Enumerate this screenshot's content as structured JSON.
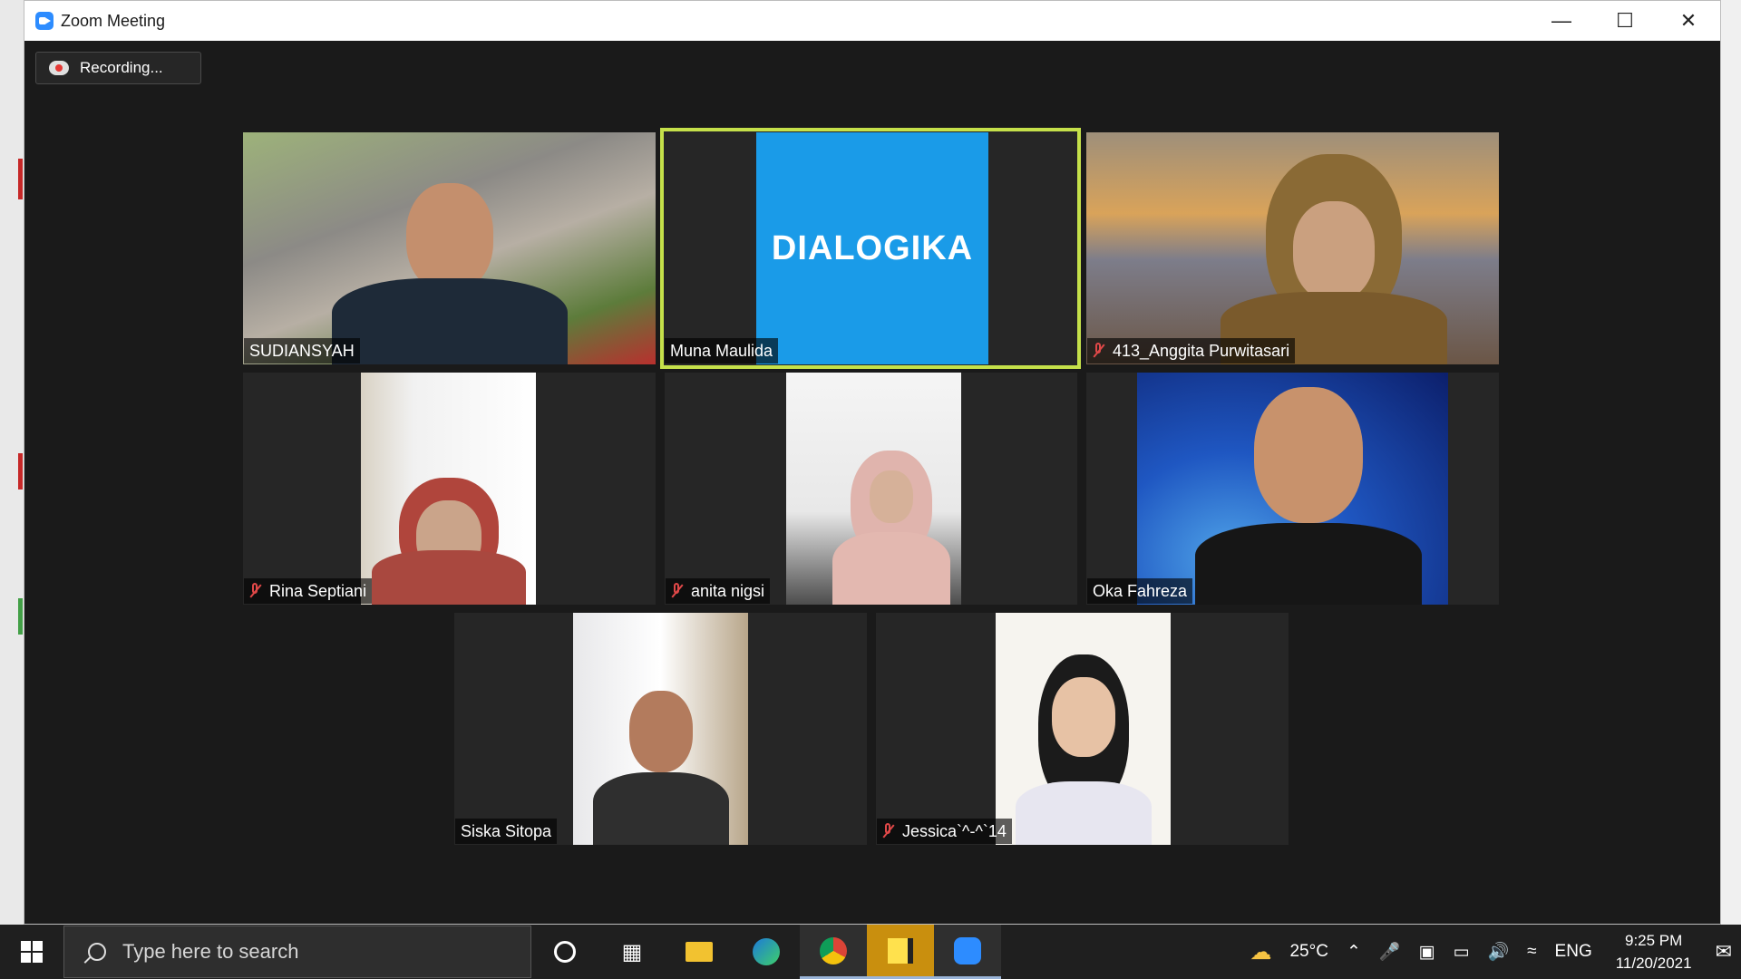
{
  "window": {
    "title": "Zoom Meeting"
  },
  "recording": {
    "label": "Recording..."
  },
  "participants": [
    {
      "name": "SUDIANSYAH",
      "muted": false,
      "active": false
    },
    {
      "name": "Muna Maulida",
      "muted": false,
      "active": true,
      "logo_text": "DIALOGIKA"
    },
    {
      "name": "413_Anggita Purwitasari",
      "muted": true,
      "active": false
    },
    {
      "name": "Rina Septiani",
      "muted": true,
      "active": false
    },
    {
      "name": "anita nigsi",
      "muted": true,
      "active": false
    },
    {
      "name": "Oka Fahreza",
      "muted": false,
      "active": false
    },
    {
      "name": "Siska Sitopa",
      "muted": false,
      "active": false
    },
    {
      "name": "Jessica`^-^`14",
      "muted": true,
      "active": false
    }
  ],
  "taskbar": {
    "search_placeholder": "Type here to search",
    "apps": [
      "cortana-icon",
      "task-view-icon",
      "file-explorer-icon",
      "edge-icon",
      "chrome-icon",
      "sticky-notes-icon",
      "zoom-icon"
    ],
    "weather": "25°C",
    "language": "ENG",
    "time": "9:25 PM",
    "date": "11/20/2021"
  },
  "colors": {
    "active_speaker": "#c5e04a",
    "dialogika_blue": "#1a9be8",
    "muted_red": "#e04848"
  }
}
